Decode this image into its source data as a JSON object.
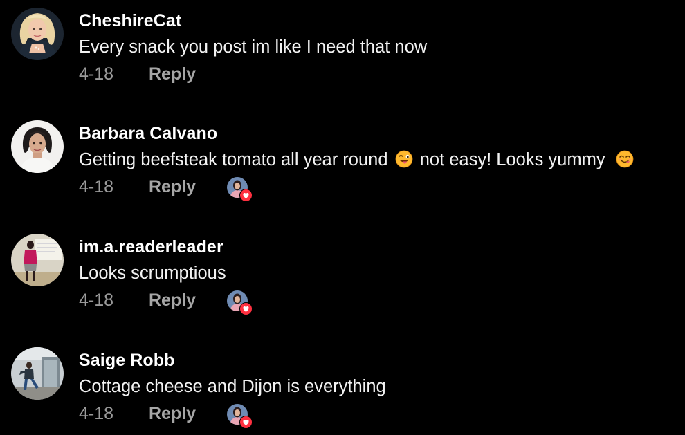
{
  "colors": {
    "background": "#000000",
    "author": "#ffffff",
    "text": "#f2f2f2",
    "meta": "#9a9a9a",
    "heart_badge": "#ff3040"
  },
  "comments": [
    {
      "author": "CheshireCat",
      "text_parts": [
        "Every snack you post im like I need that now"
      ],
      "emojis": [],
      "date": "4-18",
      "reply_label": "Reply",
      "liked_by_creator": false,
      "avatar_icon": "blonde-woman-avatar-icon"
    },
    {
      "author": "Barbara Calvano",
      "text_parts": [
        "Getting beefsteak tomato all year round",
        "not easy! Looks yummy",
        ""
      ],
      "emojis": [
        "winking-tongue-emoji",
        "yum-face-emoji"
      ],
      "date": "4-18",
      "reply_label": "Reply",
      "liked_by_creator": true,
      "avatar_icon": "dark-haired-woman-avatar-icon"
    },
    {
      "author": "im.a.readerleader",
      "text_parts": [
        "Looks scrumptious"
      ],
      "emojis": [],
      "date": "4-18",
      "reply_label": "Reply",
      "liked_by_creator": true,
      "avatar_icon": "woman-in-classroom-avatar-icon"
    },
    {
      "author": "Saige Robb",
      "text_parts": [
        "Cottage cheese and Dijon is everything"
      ],
      "emojis": [],
      "date": "4-18",
      "reply_label": "Reply",
      "liked_by_creator": true,
      "avatar_icon": "woman-in-doorway-avatar-icon"
    }
  ]
}
